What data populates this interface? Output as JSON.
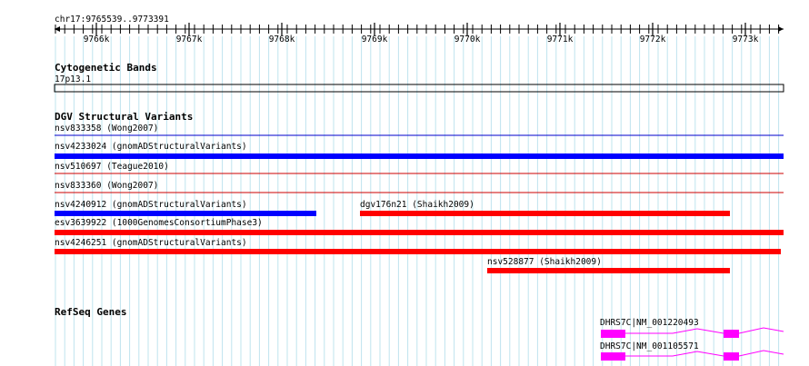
{
  "region": {
    "label": "chr17:9765539..9773391",
    "start": 9765539,
    "end": 9773391
  },
  "ruler": {
    "ticks": [
      "9766k",
      "9767k",
      "9768k",
      "9769k",
      "9770k",
      "9771k",
      "9772k",
      "9773k"
    ]
  },
  "tracks": {
    "cytoband": {
      "title": "Cytogenetic Bands",
      "band_label": "17p13.1"
    },
    "dgv": {
      "title": "DGV Structural Variants",
      "features": [
        {
          "label": "nsv833358 (Wong2007)",
          "type": "thin",
          "color": "#0000cc"
        },
        {
          "label": "nsv4233024 (gnomADStructuralVariants)",
          "type": "thick",
          "color": "#0000ff"
        },
        {
          "label": "nsv510697 (Teague2010)",
          "type": "thin",
          "color": "#cc0000"
        },
        {
          "label": "nsv833360 (Wong2007)",
          "type": "thin",
          "color": "#cc0000"
        },
        {
          "label": "nsv4240912 (gnomADStructuralVariants)",
          "type": "thick",
          "color": "#0000ff"
        },
        {
          "label": "dgv176n21 (Shaikh2009)",
          "type": "thick",
          "color": "#ff0000"
        },
        {
          "label": "esv3639922 (1000GenomesConsortiumPhase3)",
          "type": "thick",
          "color": "#ff0000"
        },
        {
          "label": "nsv4246251 (gnomADStructuralVariants)",
          "type": "thick",
          "color": "#ff0000"
        },
        {
          "label": "nsv528877 (Shaikh2009)",
          "type": "thick",
          "color": "#ff0000"
        }
      ]
    },
    "refseq": {
      "title": "RefSeq Genes",
      "features": [
        {
          "label": "DHRS7C|NM_001220493",
          "color": "#ff00ff"
        },
        {
          "label": "DHRS7C|NM_001105571",
          "color": "#ff00ff"
        }
      ]
    }
  }
}
